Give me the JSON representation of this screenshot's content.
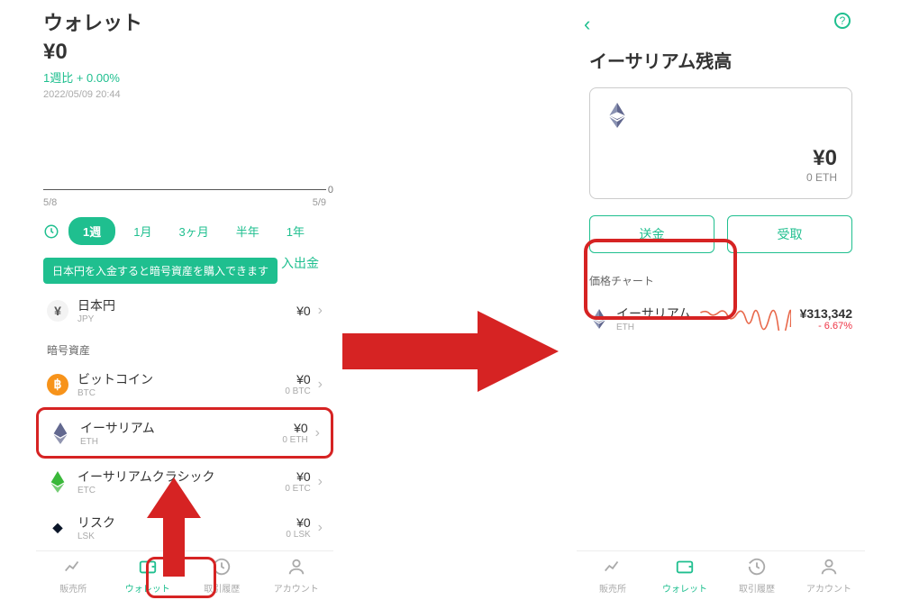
{
  "left": {
    "title": "ウォレット",
    "balance": "¥0",
    "week_change": "1週比 + 0.00%",
    "timestamp": "2022/05/09 20:44",
    "chart_zero": "0",
    "date_start": "5/8",
    "date_end": "5/9",
    "periods": [
      "1週",
      "1月",
      "3ヶ月",
      "半年",
      "1年"
    ],
    "active_period_index": 0,
    "tooltip": "日本円を入金すると暗号資産を購入できます",
    "deposit_link": "入出金",
    "fiat": {
      "name": "日本円",
      "ticker": "JPY",
      "value": "¥0"
    },
    "crypto_label": "暗号資産",
    "assets": [
      {
        "name": "ビットコイン",
        "ticker": "BTC",
        "value": "¥0",
        "sub": "0 BTC",
        "color": "#f7931a",
        "glyph": "฿"
      },
      {
        "name": "イーサリアム",
        "ticker": "ETH",
        "value": "¥0",
        "sub": "0 ETH",
        "color": "#627eea",
        "highlighted": true
      },
      {
        "name": "イーサリアムクラシック",
        "ticker": "ETC",
        "value": "¥0",
        "sub": "0 ETC",
        "color": "#3ab83a"
      },
      {
        "name": "リスク",
        "ticker": "LSK",
        "value": "¥0",
        "sub": "0 LSK",
        "color": "#0b1629"
      }
    ],
    "nav": [
      {
        "label": "販売所",
        "icon": "chart"
      },
      {
        "label": "ウォレット",
        "icon": "wallet",
        "active": true
      },
      {
        "label": "取引履歴",
        "icon": "history"
      },
      {
        "label": "アカウント",
        "icon": "account"
      }
    ]
  },
  "right": {
    "back": "‹",
    "help": "?",
    "title": "イーサリアム残高",
    "card_balance": "¥0",
    "card_sub": "0 ETH",
    "send_label": "送金",
    "receive_label": "受取",
    "chart_label": "価格チャート",
    "price_name": "イーサリアム",
    "price_ticker": "ETH",
    "price_value": "¥313,342",
    "price_change": "- 6.67%",
    "spark_color": "#e8684a",
    "nav": [
      {
        "label": "販売所",
        "icon": "chart"
      },
      {
        "label": "ウォレット",
        "icon": "wallet",
        "active": true
      },
      {
        "label": "取引履歴",
        "icon": "history"
      },
      {
        "label": "アカウント",
        "icon": "account"
      }
    ]
  }
}
